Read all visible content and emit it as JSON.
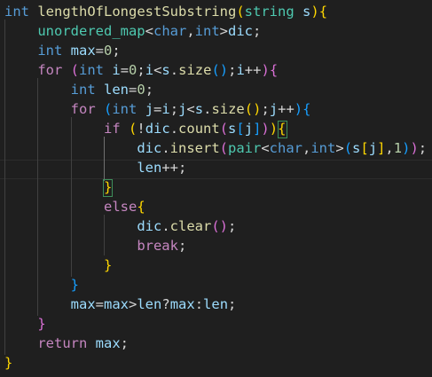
{
  "editor": {
    "lines": [
      {
        "tokens": [
          {
            "t": "int",
            "c": "kw"
          },
          {
            "t": " ",
            "c": "op"
          },
          {
            "t": "lengthOfLongestSubstring",
            "c": "fn"
          },
          {
            "t": "(",
            "c": "b1"
          },
          {
            "t": "string",
            "c": "type"
          },
          {
            "t": " ",
            "c": "op"
          },
          {
            "t": "s",
            "c": "var"
          },
          {
            "t": ")",
            "c": "b1"
          },
          {
            "t": "{",
            "c": "b1"
          }
        ]
      },
      {
        "tokens": [
          {
            "t": "    ",
            "c": "op"
          },
          {
            "t": "unordered_map",
            "c": "type"
          },
          {
            "t": "<",
            "c": "op"
          },
          {
            "t": "char",
            "c": "kw"
          },
          {
            "t": ",",
            "c": "op"
          },
          {
            "t": "int",
            "c": "kw"
          },
          {
            "t": ">",
            "c": "op"
          },
          {
            "t": "dic",
            "c": "var"
          },
          {
            "t": ";",
            "c": "op"
          }
        ]
      },
      {
        "tokens": [
          {
            "t": "    ",
            "c": "op"
          },
          {
            "t": "int",
            "c": "kw"
          },
          {
            "t": " ",
            "c": "op"
          },
          {
            "t": "max",
            "c": "var"
          },
          {
            "t": "=",
            "c": "op"
          },
          {
            "t": "0",
            "c": "num"
          },
          {
            "t": ";",
            "c": "op"
          }
        ]
      },
      {
        "tokens": [
          {
            "t": "    ",
            "c": "op"
          },
          {
            "t": "for",
            "c": "ctrl"
          },
          {
            "t": " ",
            "c": "op"
          },
          {
            "t": "(",
            "c": "b2"
          },
          {
            "t": "int",
            "c": "kw"
          },
          {
            "t": " ",
            "c": "op"
          },
          {
            "t": "i",
            "c": "var"
          },
          {
            "t": "=",
            "c": "op"
          },
          {
            "t": "0",
            "c": "num"
          },
          {
            "t": ";",
            "c": "op"
          },
          {
            "t": "i",
            "c": "var"
          },
          {
            "t": "<",
            "c": "op"
          },
          {
            "t": "s",
            "c": "var"
          },
          {
            "t": ".",
            "c": "op"
          },
          {
            "t": "size",
            "c": "fn"
          },
          {
            "t": "()",
            "c": "b3"
          },
          {
            "t": ";",
            "c": "op"
          },
          {
            "t": "i",
            "c": "var"
          },
          {
            "t": "++",
            "c": "op"
          },
          {
            "t": ")",
            "c": "b2"
          },
          {
            "t": "{",
            "c": "b2"
          }
        ]
      },
      {
        "tokens": [
          {
            "t": "        ",
            "c": "op"
          },
          {
            "t": "int",
            "c": "kw"
          },
          {
            "t": " ",
            "c": "op"
          },
          {
            "t": "len",
            "c": "var"
          },
          {
            "t": "=",
            "c": "op"
          },
          {
            "t": "0",
            "c": "num"
          },
          {
            "t": ";",
            "c": "op"
          }
        ]
      },
      {
        "tokens": [
          {
            "t": "        ",
            "c": "op"
          },
          {
            "t": "for",
            "c": "ctrl"
          },
          {
            "t": " ",
            "c": "op"
          },
          {
            "t": "(",
            "c": "b3"
          },
          {
            "t": "int",
            "c": "kw"
          },
          {
            "t": " ",
            "c": "op"
          },
          {
            "t": "j",
            "c": "var"
          },
          {
            "t": "=",
            "c": "op"
          },
          {
            "t": "i",
            "c": "var"
          },
          {
            "t": ";",
            "c": "op"
          },
          {
            "t": "j",
            "c": "var"
          },
          {
            "t": "<",
            "c": "op"
          },
          {
            "t": "s",
            "c": "var"
          },
          {
            "t": ".",
            "c": "op"
          },
          {
            "t": "size",
            "c": "fn"
          },
          {
            "t": "()",
            "c": "b1"
          },
          {
            "t": ";",
            "c": "op"
          },
          {
            "t": "j",
            "c": "var"
          },
          {
            "t": "++",
            "c": "op"
          },
          {
            "t": ")",
            "c": "b3"
          },
          {
            "t": "{",
            "c": "b3"
          }
        ]
      },
      {
        "tokens": [
          {
            "t": "            ",
            "c": "op"
          },
          {
            "t": "if",
            "c": "ctrl"
          },
          {
            "t": " ",
            "c": "op"
          },
          {
            "t": "(",
            "c": "b1"
          },
          {
            "t": "!",
            "c": "op"
          },
          {
            "t": "dic",
            "c": "var"
          },
          {
            "t": ".",
            "c": "op"
          },
          {
            "t": "count",
            "c": "fn"
          },
          {
            "t": "(",
            "c": "b2"
          },
          {
            "t": "s",
            "c": "var"
          },
          {
            "t": "[",
            "c": "b3"
          },
          {
            "t": "j",
            "c": "var"
          },
          {
            "t": "]",
            "c": "b3"
          },
          {
            "t": ")",
            "c": "b2"
          },
          {
            "t": ")",
            "c": "b1"
          },
          {
            "t": "{",
            "c": "b1"
          }
        ]
      },
      {
        "tokens": [
          {
            "t": "                ",
            "c": "op"
          },
          {
            "t": "dic",
            "c": "var"
          },
          {
            "t": ".",
            "c": "op"
          },
          {
            "t": "insert",
            "c": "fn"
          },
          {
            "t": "(",
            "c": "b2"
          },
          {
            "t": "pair",
            "c": "type"
          },
          {
            "t": "<",
            "c": "op"
          },
          {
            "t": "char",
            "c": "kw"
          },
          {
            "t": ",",
            "c": "op"
          },
          {
            "t": "int",
            "c": "kw"
          },
          {
            "t": ">",
            "c": "op"
          },
          {
            "t": "(",
            "c": "b3"
          },
          {
            "t": "s",
            "c": "var"
          },
          {
            "t": "[",
            "c": "b1"
          },
          {
            "t": "j",
            "c": "var"
          },
          {
            "t": "]",
            "c": "b1"
          },
          {
            "t": ",",
            "c": "op"
          },
          {
            "t": "1",
            "c": "num"
          },
          {
            "t": ")",
            "c": "b3"
          },
          {
            "t": ")",
            "c": "b2"
          },
          {
            "t": ";",
            "c": "op"
          }
        ]
      },
      {
        "tokens": [
          {
            "t": "                ",
            "c": "op"
          },
          {
            "t": "len",
            "c": "var"
          },
          {
            "t": "++",
            "c": "op"
          },
          {
            "t": ";",
            "c": "op"
          }
        ]
      },
      {
        "tokens": [
          {
            "t": "            ",
            "c": "op"
          },
          {
            "t": "}",
            "c": "b1"
          }
        ]
      },
      {
        "tokens": [
          {
            "t": "            ",
            "c": "op"
          },
          {
            "t": "else",
            "c": "ctrl"
          },
          {
            "t": "{",
            "c": "b1"
          }
        ]
      },
      {
        "tokens": [
          {
            "t": "                ",
            "c": "op"
          },
          {
            "t": "dic",
            "c": "var"
          },
          {
            "t": ".",
            "c": "op"
          },
          {
            "t": "clear",
            "c": "fn"
          },
          {
            "t": "()",
            "c": "b2"
          },
          {
            "t": ";",
            "c": "op"
          }
        ]
      },
      {
        "tokens": [
          {
            "t": "                ",
            "c": "op"
          },
          {
            "t": "break",
            "c": "ctrl"
          },
          {
            "t": ";",
            "c": "op"
          }
        ]
      },
      {
        "tokens": [
          {
            "t": "            ",
            "c": "op"
          },
          {
            "t": "}",
            "c": "b1"
          }
        ]
      },
      {
        "tokens": [
          {
            "t": "        ",
            "c": "op"
          },
          {
            "t": "}",
            "c": "b3"
          }
        ]
      },
      {
        "tokens": [
          {
            "t": "        ",
            "c": "op"
          },
          {
            "t": "max",
            "c": "var"
          },
          {
            "t": "=",
            "c": "op"
          },
          {
            "t": "max",
            "c": "var"
          },
          {
            "t": ">",
            "c": "op"
          },
          {
            "t": "len",
            "c": "var"
          },
          {
            "t": "?",
            "c": "op"
          },
          {
            "t": "max",
            "c": "var"
          },
          {
            "t": ":",
            "c": "op"
          },
          {
            "t": "len",
            "c": "var"
          },
          {
            "t": ";",
            "c": "op"
          }
        ]
      },
      {
        "tokens": [
          {
            "t": "    ",
            "c": "op"
          },
          {
            "t": "}",
            "c": "b2"
          }
        ]
      },
      {
        "tokens": [
          {
            "t": "    ",
            "c": "op"
          },
          {
            "t": "return",
            "c": "ctrl"
          },
          {
            "t": " ",
            "c": "op"
          },
          {
            "t": "max",
            "c": "var"
          },
          {
            "t": ";",
            "c": "op"
          }
        ]
      },
      {
        "tokens": [
          {
            "t": "}",
            "c": "b1"
          }
        ]
      }
    ]
  },
  "colors": {
    "background": "#1f1f1f",
    "keyword": "#569cd6",
    "control": "#c586c0",
    "function": "#dcdcaa",
    "type": "#4ec9b0",
    "variable": "#9cdcfe",
    "number": "#b5cea8",
    "bracket_gold": "#ffd700",
    "bracket_orchid": "#da70d6",
    "bracket_blue": "#179fff",
    "active_bracket_border": "#3e8f5b"
  }
}
